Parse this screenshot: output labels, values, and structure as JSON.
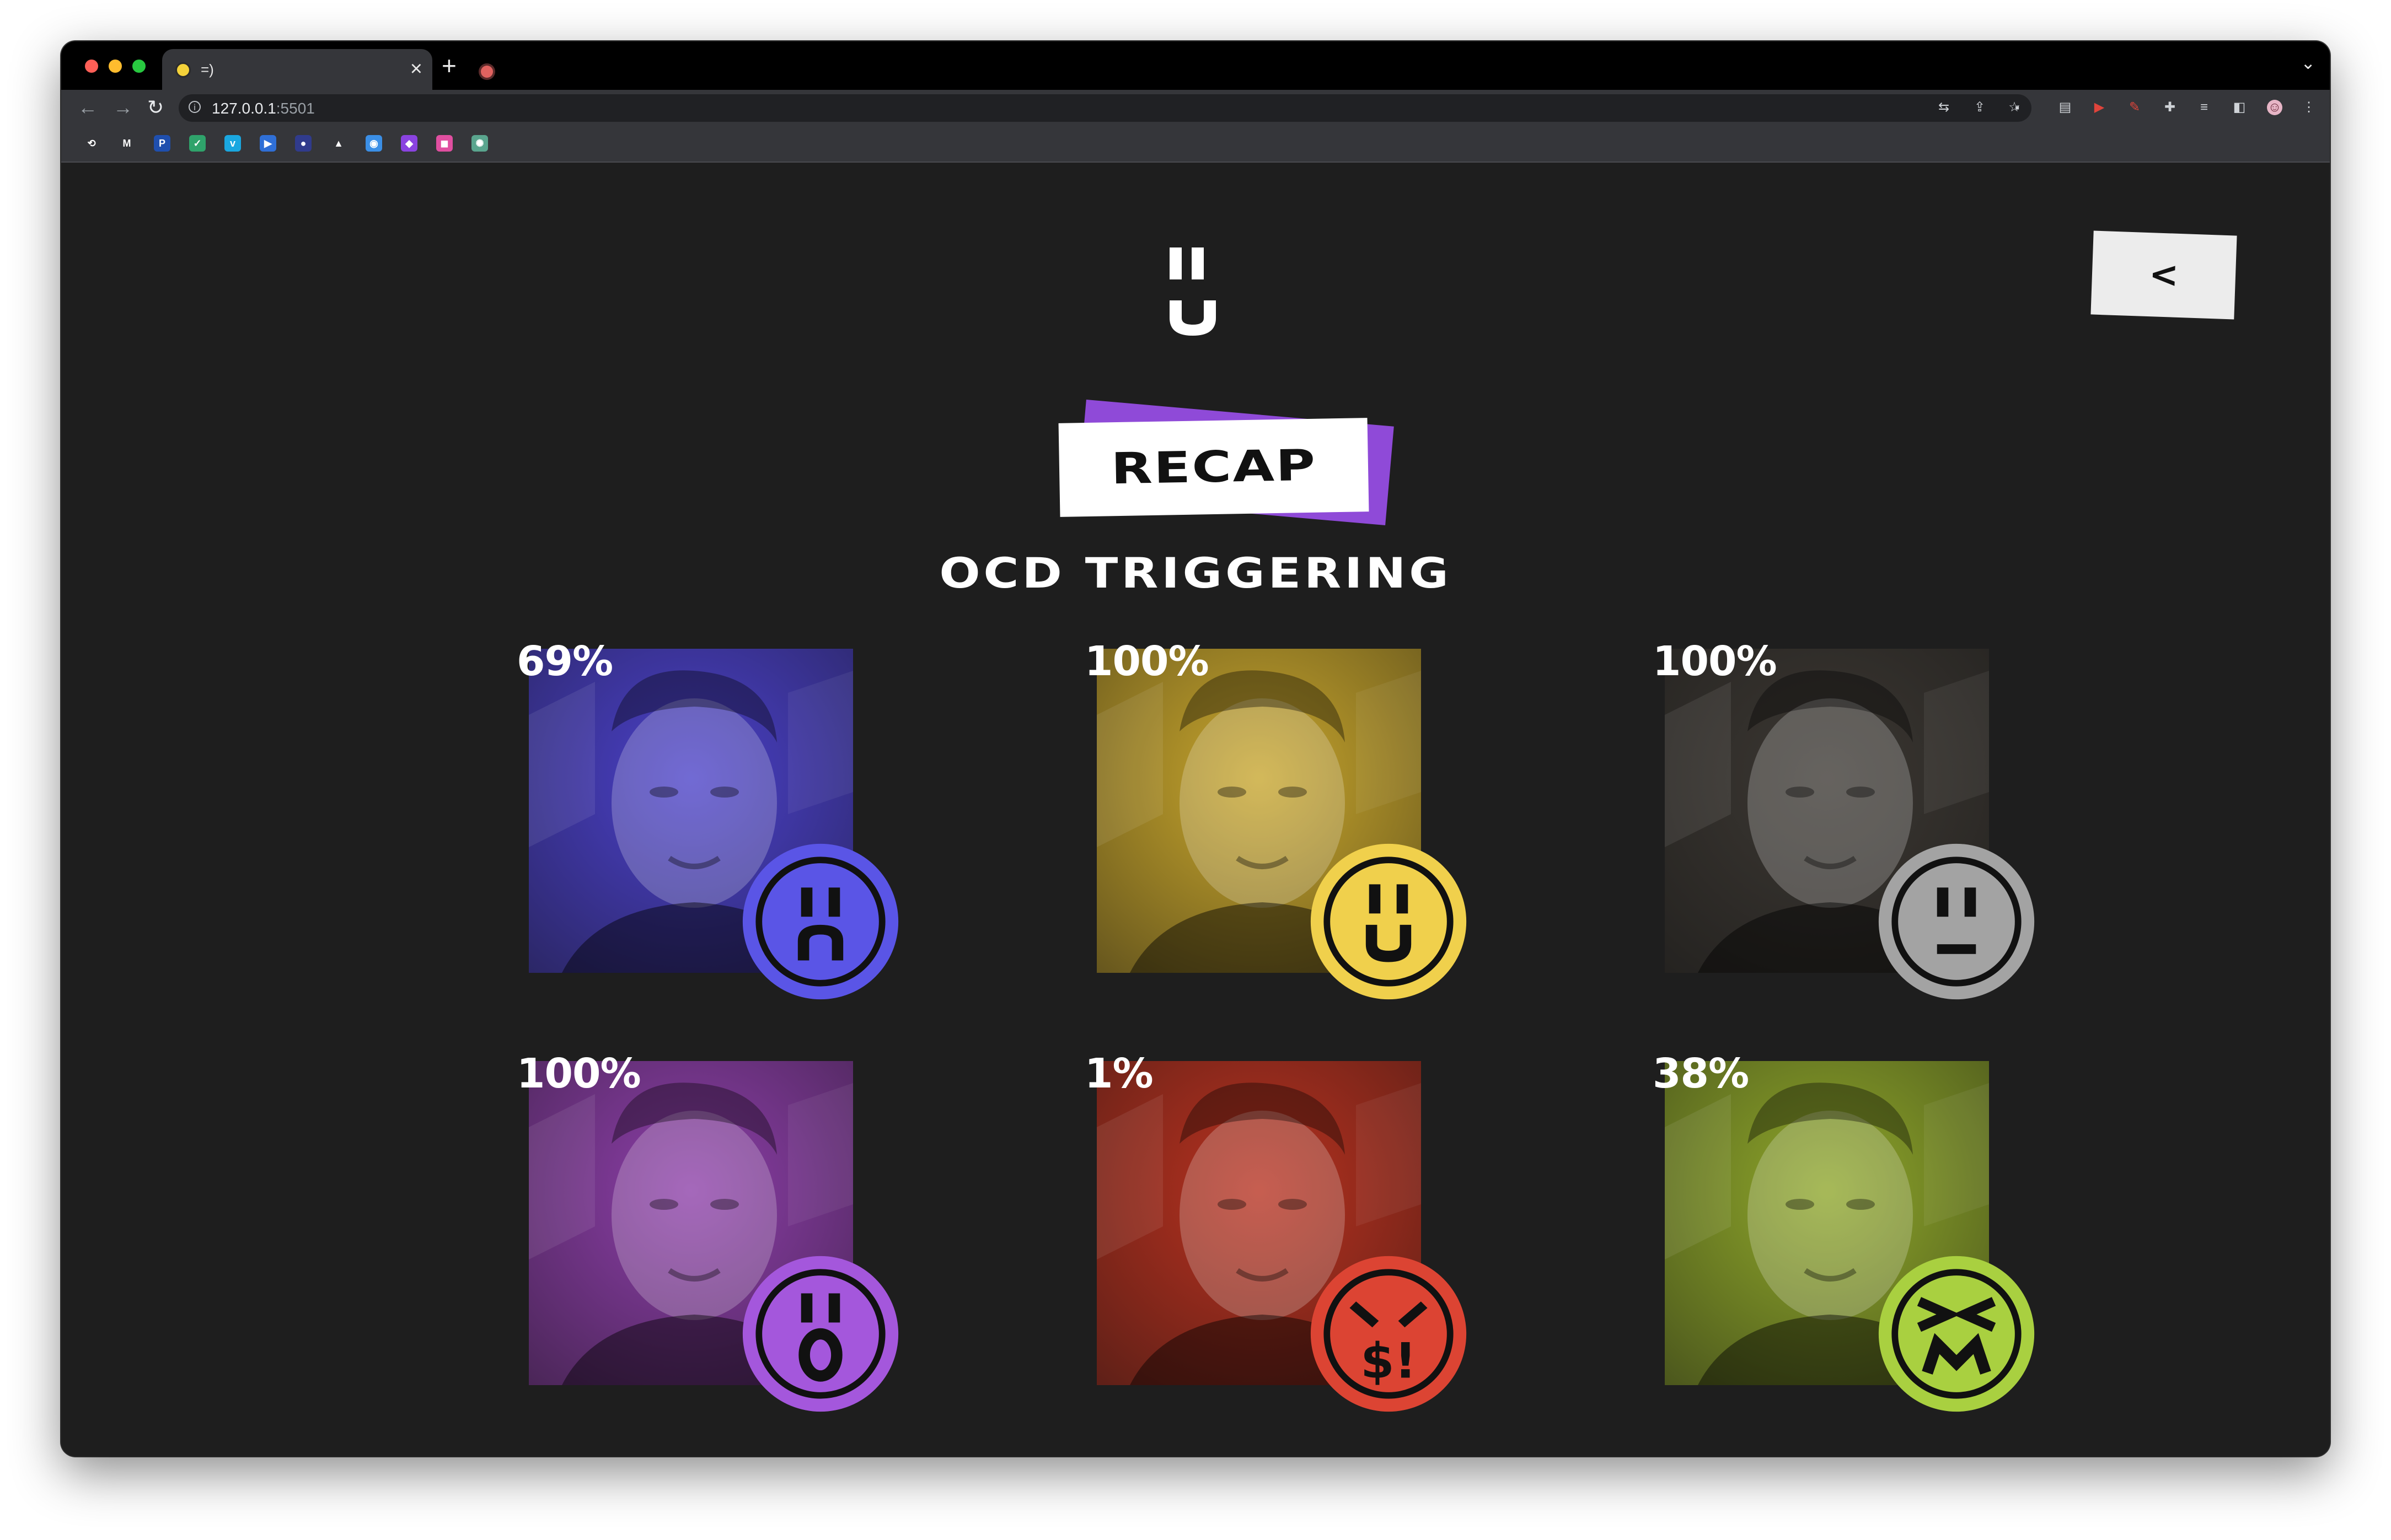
{
  "browser": {
    "tab_title": "=)",
    "new_tab_symbol": "+",
    "close_symbol": "×",
    "url_host": "127.0.0.1",
    "url_port": ":5501",
    "traffic_colors": [
      "#fe5f57",
      "#febc2e",
      "#28c840"
    ],
    "bookmarks": [
      {
        "name": "history-bookmark",
        "glyph": "⟲",
        "color": "#35363a"
      },
      {
        "name": "gmail-bookmark",
        "glyph": "M",
        "color": "#35363a"
      },
      {
        "name": "paypal-bookmark",
        "glyph": "P",
        "color": "#1f4fae"
      },
      {
        "name": "vuejs-bookmark",
        "glyph": "✓",
        "color": "#2fa36b"
      },
      {
        "name": "vimeo-bookmark",
        "glyph": "v",
        "color": "#1aa7e0"
      },
      {
        "name": "play-bookmark",
        "glyph": "▶",
        "color": "#2f6fd6"
      },
      {
        "name": "circle-bookmark",
        "glyph": "●",
        "color": "#303b8c"
      },
      {
        "name": "drive-bookmark",
        "glyph": "▲",
        "color": "#35363a"
      },
      {
        "name": "app-bookmark",
        "glyph": "◉",
        "color": "#3b8fe6"
      },
      {
        "name": "twitch-bookmark",
        "glyph": "◆",
        "color": "#8a43e0"
      },
      {
        "name": "figma-bookmark",
        "glyph": "◼",
        "color": "#e04fa0"
      },
      {
        "name": "chatgpt-bookmark",
        "glyph": "✺",
        "color": "#5aa58e"
      }
    ]
  },
  "page": {
    "back_label": "<",
    "heading": "RECAP",
    "subtitle": "OCD TRIGGERING",
    "cards": [
      {
        "percent": "69%",
        "color": "#5a55e6",
        "tint": "#4a40c8",
        "face": "sad-face-icon"
      },
      {
        "percent": "100%",
        "color": "#f0d04c",
        "tint": "#c7a52c",
        "face": "happy-face-icon"
      },
      {
        "percent": "100%",
        "color": "#a3a3a3",
        "tint": "#3b3732",
        "face": "neutral-face-icon"
      },
      {
        "percent": "100%",
        "color": "#a457dc",
        "tint": "#8c3ea8",
        "face": "surprised-face-icon"
      },
      {
        "percent": "1%",
        "color": "#dc4433",
        "tint": "#b7311f",
        "face": "angry-face-icon"
      },
      {
        "percent": "38%",
        "color": "#a9d040",
        "tint": "#8ea62a",
        "face": "squint-face-icon"
      }
    ]
  }
}
